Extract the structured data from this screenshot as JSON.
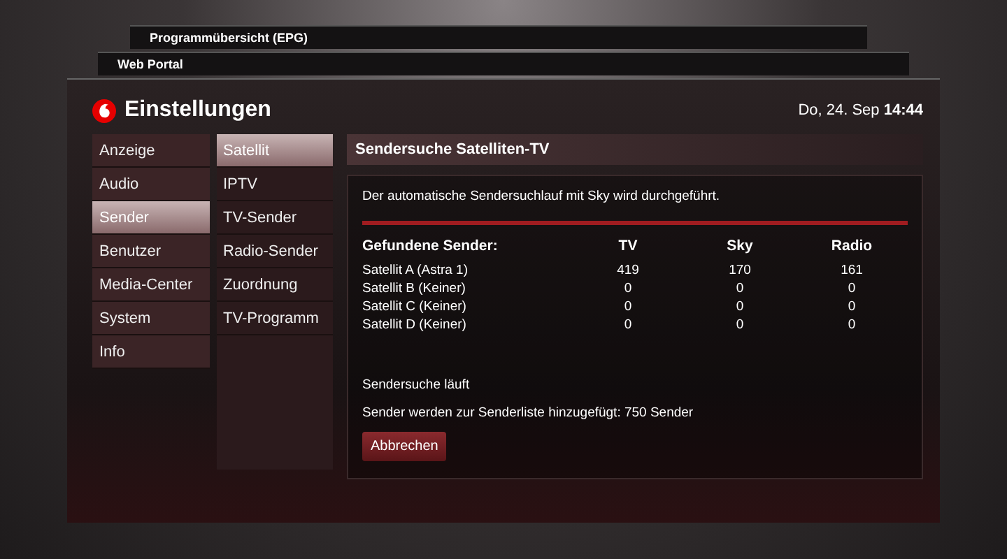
{
  "background_windows": [
    {
      "title": "Programmübersicht (EPG)"
    },
    {
      "title": "Web Portal"
    }
  ],
  "window": {
    "title": "Einstellungen",
    "date": "Do, 24. Sep",
    "time": "14:44"
  },
  "menu": [
    {
      "label": "Anzeige",
      "selected": false
    },
    {
      "label": "Audio",
      "selected": false
    },
    {
      "label": "Sender",
      "selected": true
    },
    {
      "label": "Benutzer",
      "selected": false
    },
    {
      "label": "Media-Center",
      "selected": false
    },
    {
      "label": "System",
      "selected": false
    },
    {
      "label": "Info",
      "selected": false
    }
  ],
  "submenu": [
    {
      "label": "Satellit",
      "selected": true
    },
    {
      "label": "IPTV",
      "selected": false
    },
    {
      "label": "TV-Sender",
      "selected": false
    },
    {
      "label": "Radio-Sender",
      "selected": false
    },
    {
      "label": "Zuordnung",
      "selected": false
    },
    {
      "label": "TV-Programm",
      "selected": false
    }
  ],
  "panel": {
    "title": "Sendersuche Satelliten-TV",
    "message": "Der automatische Sendersuchlauf mit Sky wird durchgeführt.",
    "table": {
      "columns": [
        "Gefundene Sender:",
        "TV",
        "Sky",
        "Radio"
      ],
      "rows": [
        [
          "Satellit A (Astra 1)",
          "419",
          "170",
          "161"
        ],
        [
          "Satellit B (Keiner)",
          "0",
          "0",
          "0"
        ],
        [
          "Satellit C (Keiner)",
          "0",
          "0",
          "0"
        ],
        [
          "Satellit D (Keiner)",
          "0",
          "0",
          "0"
        ]
      ]
    },
    "status": "Sendersuche läuft",
    "progress_text": "Sender werden zur Senderliste hinzugefügt: 750 Sender",
    "button": "Abbrechen"
  }
}
